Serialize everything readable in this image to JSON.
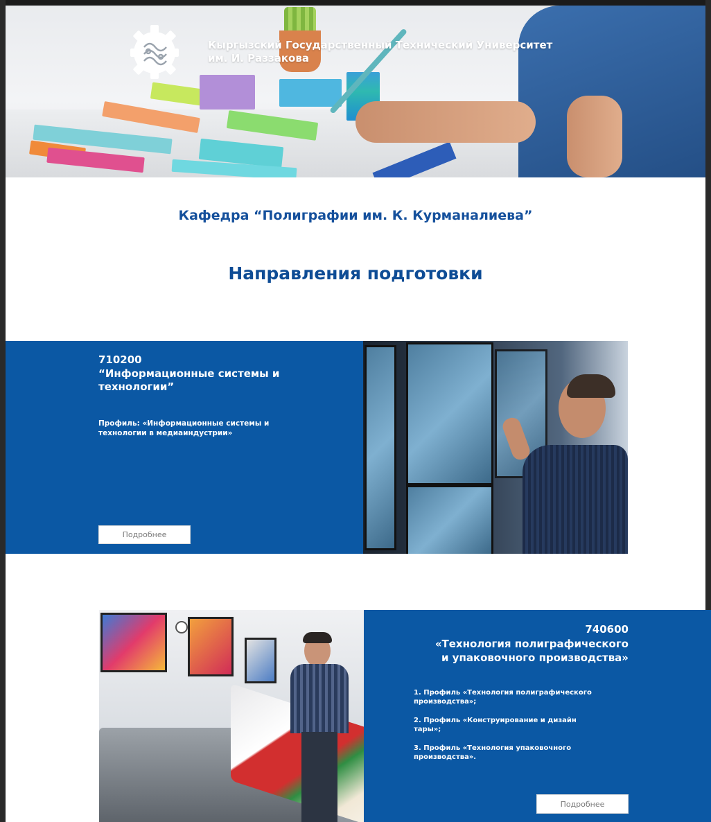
{
  "header": {
    "university_name_line1": "Кыргызский Государственный Технический Университет",
    "university_name_line2": "им. И. Раззакова"
  },
  "department": {
    "title": "Кафедра “Полиграфии им. К. Курманалиева”"
  },
  "section": {
    "title": "Направления подготовки"
  },
  "programs": [
    {
      "code": "710200",
      "name_line1": "“Информационные системы и",
      "name_line2": "технологии”",
      "profile_line1": "Профиль: «Информационные системы и",
      "profile_line2": "технологии в медиаиндустрии»",
      "button_label": "Подробнее"
    },
    {
      "code": "740600",
      "name_line1": "«Технология полиграфического",
      "name_line2": "и упаковочного производства»",
      "profiles": [
        [
          "1. Профиль «Технология полиграфического",
          "производства»;"
        ],
        [
          "2. Профиль «Конструирование и дизайн",
          "тары»;"
        ],
        [
          "3. Профиль «Технология упаковочного",
          "производства»."
        ]
      ],
      "button_label": "Подробнее"
    }
  ],
  "colors": {
    "brand_blue": "#0b58a4",
    "heading_blue": "#15509c",
    "background": "#ffffff"
  },
  "icons": {
    "logo": "kstu-gear-ornament-logo"
  }
}
